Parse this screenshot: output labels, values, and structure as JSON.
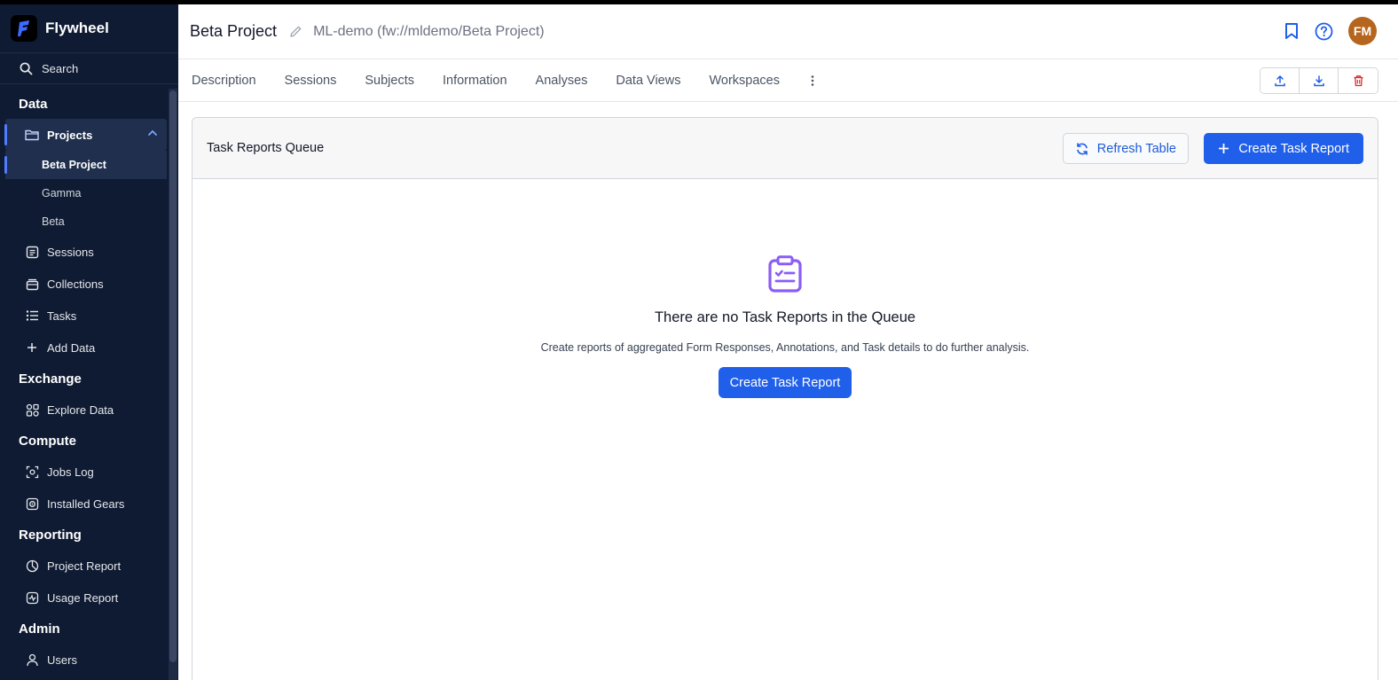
{
  "brand": {
    "name": "Flywheel"
  },
  "sidebar": {
    "search_label": "Search",
    "sections": {
      "data": "Data",
      "exchange": "Exchange",
      "compute": "Compute",
      "reporting": "Reporting",
      "admin": "Admin"
    },
    "items": {
      "projects": "Projects",
      "beta_project": "Beta Project",
      "gamma": "Gamma",
      "beta": "Beta",
      "sessions": "Sessions",
      "collections": "Collections",
      "tasks": "Tasks",
      "add_data": "Add Data",
      "explore_data": "Explore Data",
      "jobs_log": "Jobs Log",
      "installed_gears": "Installed Gears",
      "project_report": "Project Report",
      "usage_report": "Usage Report",
      "users": "Users"
    }
  },
  "header": {
    "title": "Beta Project",
    "path": "ML-demo (fw://mldemo/Beta Project)",
    "avatar_initials": "FM"
  },
  "tabs": [
    "Description",
    "Sessions",
    "Subjects",
    "Information",
    "Analyses",
    "Data Views",
    "Workspaces"
  ],
  "panel": {
    "title": "Task Reports Queue",
    "refresh_label": "Refresh Table",
    "create_label": "Create Task Report",
    "empty_title": "There are no Task Reports in the Queue",
    "empty_desc": "Create reports of aggregated Form Responses, Annotations, and Task details to do further analysis.",
    "empty_button": "Create Task Report"
  },
  "colors": {
    "sidebar_bg": "#0f1b33",
    "accent": "#1f5fea",
    "empty_icon": "#8b5cf6",
    "avatar": "#b5651d",
    "delete": "#dc2626"
  }
}
